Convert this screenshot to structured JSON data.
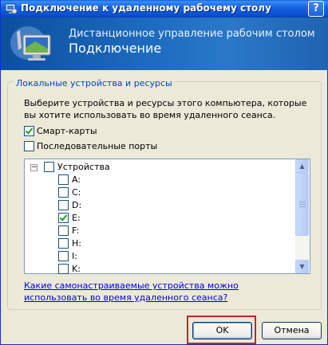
{
  "window": {
    "title": "Подключение к удаленному рабочему столу",
    "help_label": "?"
  },
  "banner": {
    "subtitle": "Дистанционное управление рабочим столом",
    "title": "Подключение"
  },
  "group": {
    "legend": "Локальные устройства и ресурсы",
    "description": "Выберите устройства и ресурсы этого компьютера, которые вы хотите использовать во время удаленного сеанса."
  },
  "options": [
    {
      "label": "Смарт-карты",
      "checked": true
    },
    {
      "label": "Последовательные порты",
      "checked": false
    }
  ],
  "tree": {
    "expander": "−",
    "root": {
      "label": "Устройства",
      "checked": false
    },
    "drives": [
      {
        "label": "A:",
        "checked": false
      },
      {
        "label": "C:",
        "checked": false
      },
      {
        "label": "D:",
        "checked": false
      },
      {
        "label": "E:",
        "checked": true
      },
      {
        "label": "F:",
        "checked": false
      },
      {
        "label": "H:",
        "checked": false
      },
      {
        "label": "I:",
        "checked": false
      },
      {
        "label": "K:",
        "checked": false
      }
    ]
  },
  "help_link": "Какие самонастраиваемые устройства можно использовать во время удаленного сеанса?",
  "buttons": {
    "ok": "OK",
    "cancel": "Отмена"
  },
  "colors": {
    "titlebar": "#0b50d0",
    "accent_legend": "#0046d5",
    "highlight": "#c0262d"
  },
  "icons": {
    "title": "remote-desktop-icon",
    "banner": "remote-desktop-monitor-icon",
    "scroll_up": "scroll-up-arrow-icon",
    "scroll_down": "scroll-down-arrow-icon"
  }
}
